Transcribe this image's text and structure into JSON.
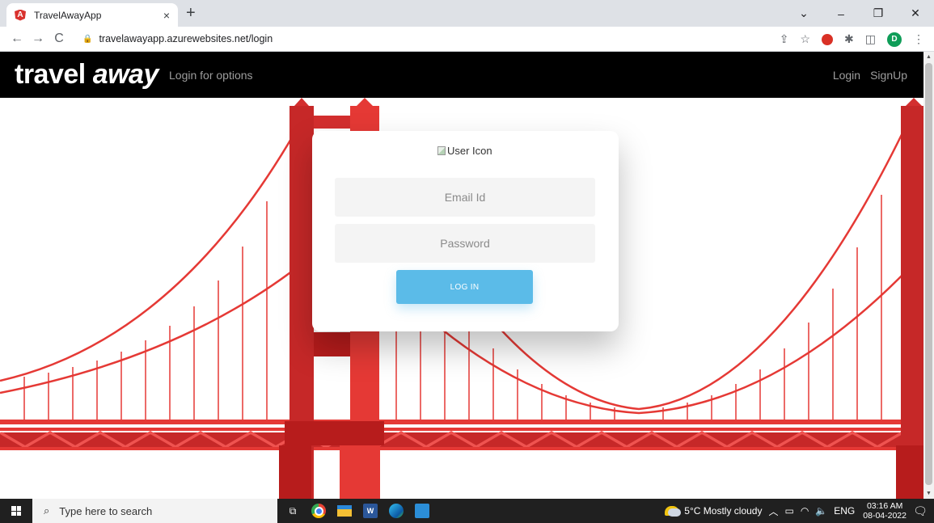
{
  "browser": {
    "tab_title": "TravelAwayApp",
    "tab_close": "×",
    "new_tab": "+",
    "url": "travelawayapp.azurewebsites.net/login",
    "window_controls": {
      "dropdown": "⌄",
      "minimize": "–",
      "restore": "❐",
      "close": "✕"
    },
    "nav": {
      "back": "←",
      "forward": "→",
      "reload": "C"
    },
    "profile_initial": "D"
  },
  "navbar": {
    "brand_part1": "travel ",
    "brand_part2": "away",
    "options_link": "Login for options",
    "login_link": "Login",
    "signup_link": "SignUp"
  },
  "login_card": {
    "user_icon_alt": "User Icon",
    "email_placeholder": "Email Id",
    "password_placeholder": "Password",
    "login_button": "LOG IN"
  },
  "taskbar": {
    "search_placeholder": "Type here to search",
    "word_label": "W",
    "weather": "5°C  Mostly cloudy",
    "language": "ENG",
    "time": "03:16 AM",
    "date": "08-04-2022"
  },
  "colors": {
    "bridge_red": "#e53935",
    "bridge_dark": "#b71c1c",
    "login_button": "#5bbbe8",
    "navbar": "#000000"
  }
}
